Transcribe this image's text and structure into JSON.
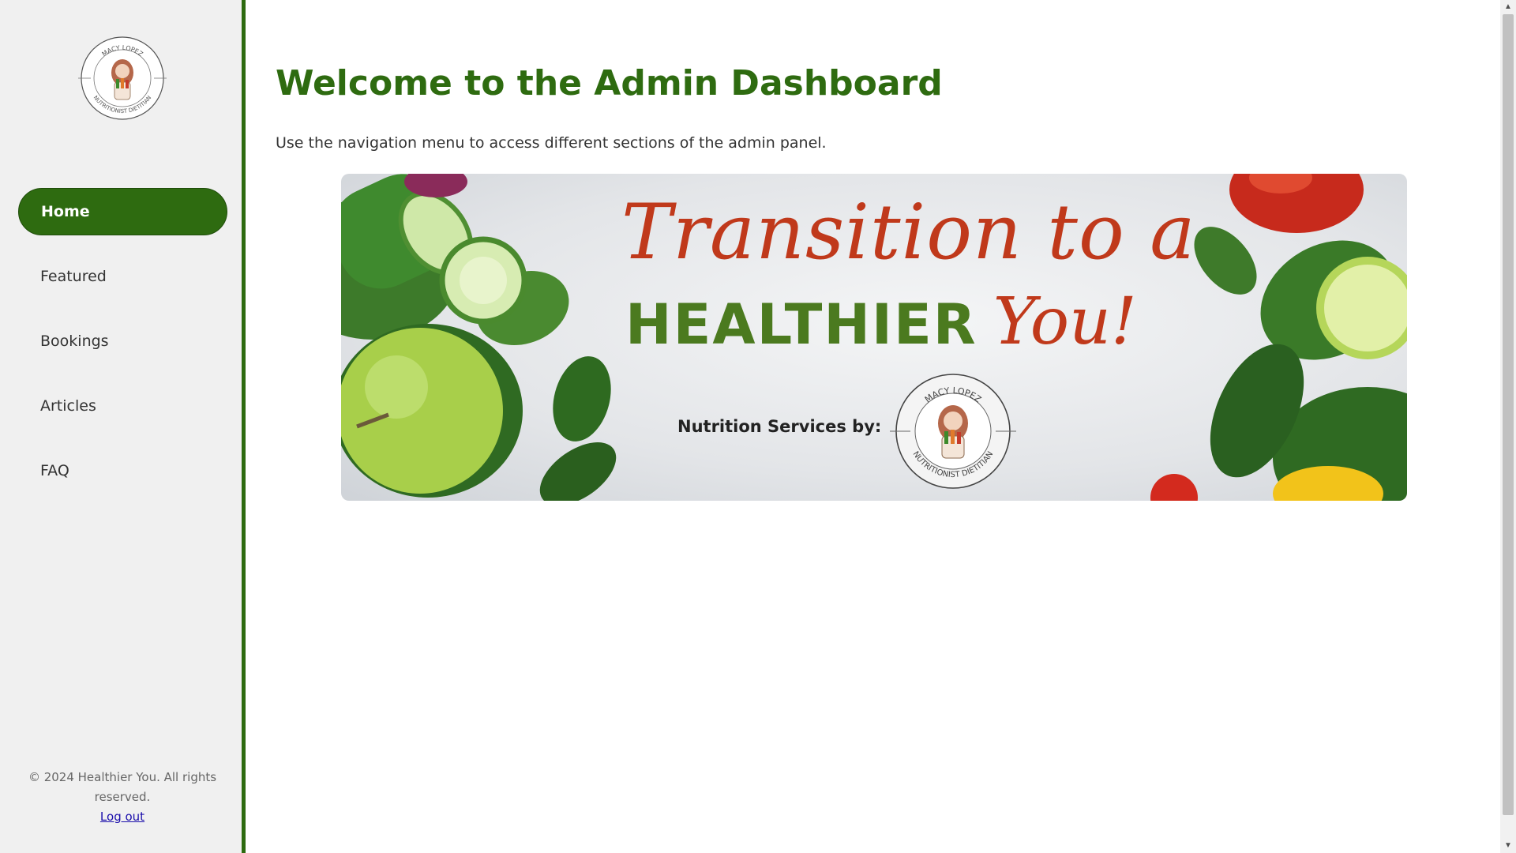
{
  "sidebar": {
    "logo_icon": "macy-lopez-nutritionist-logo",
    "logo_text_top": "MACY LOPEZ",
    "logo_text_bottom": "NUTRITIONIST DIETITIAN",
    "items": [
      {
        "label": "Home",
        "active": true
      },
      {
        "label": "Featured",
        "active": false
      },
      {
        "label": "Bookings",
        "active": false
      },
      {
        "label": "Articles",
        "active": false
      },
      {
        "label": "FAQ",
        "active": false
      }
    ],
    "footer_text": "© 2024 Healthier You. All rights reserved.",
    "logout_label": "Log out"
  },
  "main": {
    "title": "Welcome to the Admin Dashboard",
    "description": "Use the navigation menu to access different sections of the admin panel."
  },
  "banner": {
    "line1": "Transition to a",
    "line2_word1": "HEALTHIER",
    "line2_word2": "You!",
    "services_label": "Nutrition Services by:",
    "logo_text_top": "MACY LOPEZ",
    "logo_text_bottom": "NUTRITIONIST DIETITIAN"
  },
  "colors": {
    "accent": "#2e6b10",
    "sidebar_bg": "#f0f0f0",
    "banner_red": "#c0391b",
    "banner_green": "#4b7a1f"
  }
}
